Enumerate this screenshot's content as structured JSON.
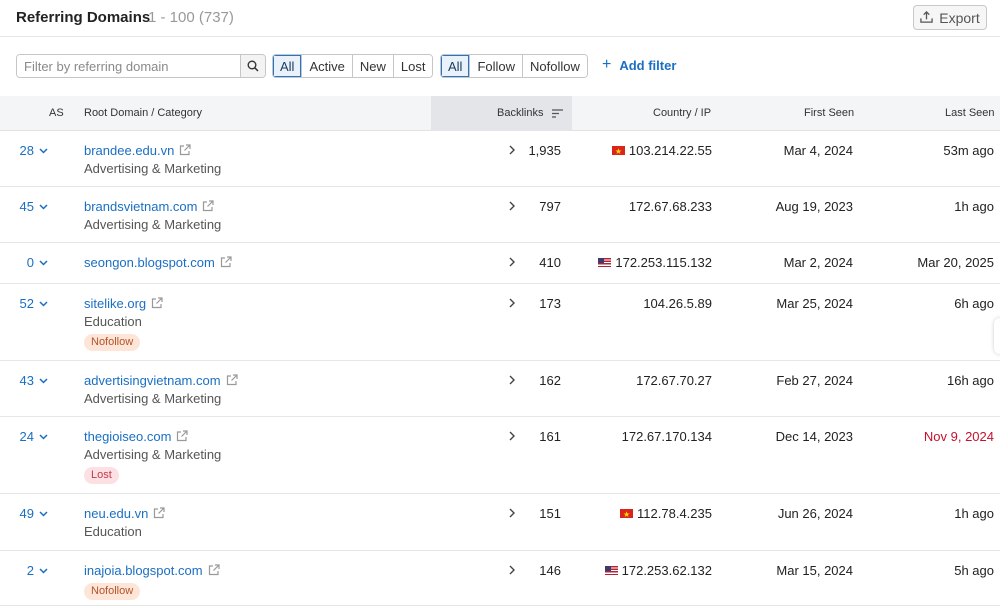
{
  "header": {
    "title": "Referring Domains",
    "count": "1 - 100 (737)",
    "export_label": "Export"
  },
  "filters": {
    "search_placeholder": "Filter by referring domain",
    "status": [
      "All",
      "Active",
      "New",
      "Lost"
    ],
    "status_selected": "All",
    "link_type": [
      "All",
      "Follow",
      "Nofollow"
    ],
    "link_type_selected": "All",
    "add_filter": "Add filter"
  },
  "table": {
    "columns": {
      "as": "AS",
      "domain": "Root Domain / Category",
      "backlinks": "Backlinks",
      "country_ip": "Country / IP",
      "first_seen": "First Seen",
      "last_seen": "Last Seen"
    },
    "sorted_column": "Backlinks",
    "rows": [
      {
        "as": "28",
        "domain": "brandee.edu.vn",
        "category": "Advertising & Marketing",
        "tag": "",
        "backlinks": "1,935",
        "flag": "vn",
        "ip": "103.214.22.55",
        "first_seen": "Mar 4, 2024",
        "last_seen": "53m ago",
        "last_seen_lost": false
      },
      {
        "as": "45",
        "domain": "brandsvietnam.com",
        "category": "Advertising & Marketing",
        "tag": "",
        "backlinks": "797",
        "flag": "",
        "ip": "172.67.68.233",
        "first_seen": "Aug 19, 2023",
        "last_seen": "1h ago",
        "last_seen_lost": false
      },
      {
        "as": "0",
        "domain": "seongon.blogspot.com",
        "category": "",
        "tag": "",
        "backlinks": "410",
        "flag": "us",
        "ip": "172.253.115.132",
        "first_seen": "Mar 2, 2024",
        "last_seen": "Mar 20, 2025",
        "last_seen_lost": false
      },
      {
        "as": "52",
        "domain": "sitelike.org",
        "category": "Education",
        "tag": "Nofollow",
        "backlinks": "173",
        "flag": "",
        "ip": "104.26.5.89",
        "first_seen": "Mar 25, 2024",
        "last_seen": "6h ago",
        "last_seen_lost": false
      },
      {
        "as": "43",
        "domain": "advertisingvietnam.com",
        "category": "Advertising & Marketing",
        "tag": "",
        "backlinks": "162",
        "flag": "",
        "ip": "172.67.70.27",
        "first_seen": "Feb 27, 2024",
        "last_seen": "16h ago",
        "last_seen_lost": false
      },
      {
        "as": "24",
        "domain": "thegioiseo.com",
        "category": "Advertising & Marketing",
        "tag": "Lost",
        "backlinks": "161",
        "flag": "",
        "ip": "172.67.170.134",
        "first_seen": "Dec 14, 2023",
        "last_seen": "Nov 9, 2024",
        "last_seen_lost": true
      },
      {
        "as": "49",
        "domain": "neu.edu.vn",
        "category": "Education",
        "tag": "",
        "backlinks": "151",
        "flag": "vn",
        "ip": "112.78.4.235",
        "first_seen": "Jun 26, 2024",
        "last_seen": "1h ago",
        "last_seen_lost": false
      },
      {
        "as": "2",
        "domain": "inajoia.blogspot.com",
        "category": "",
        "tag": "Nofollow",
        "backlinks": "146",
        "flag": "us",
        "ip": "172.253.62.132",
        "first_seen": "Mar 15, 2024",
        "last_seen": "5h ago",
        "last_seen_lost": false
      }
    ]
  },
  "colors": {
    "link": "#1a6fc4",
    "lost_text": "#c8102e",
    "nofollow_tag_bg": "#fde6d7",
    "lost_tag_bg": "#fde0e3"
  },
  "icons": {
    "export": "export-upload-icon",
    "search": "search-icon",
    "add_filter": "plus-icon",
    "sort": "sort-lines-icon",
    "external_link": "external-link-icon",
    "expand": "chevron-down-icon",
    "backlinks_expand": "chevron-right-icon"
  }
}
